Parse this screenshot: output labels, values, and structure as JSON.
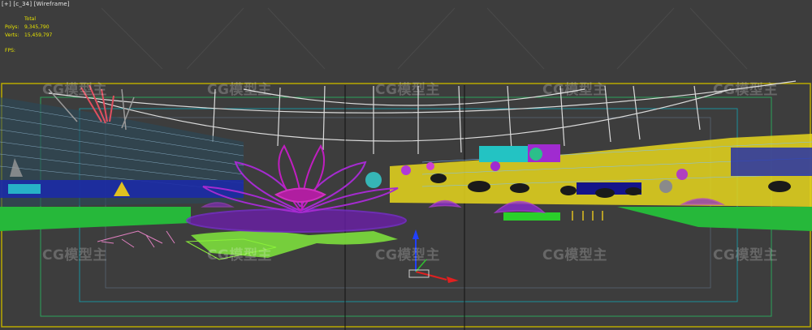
{
  "viewport": {
    "label": "[+] [c_34] [Wireframe]",
    "render_mode": "Wireframe"
  },
  "stats": {
    "header": "Total",
    "polys_label": "Polys:",
    "polys_value": "9,345,790",
    "verts_label": "Verts:",
    "verts_value": "15,459,797",
    "fps_label": "FPS:"
  },
  "watermark": {
    "text": "CG模型主"
  },
  "colors": {
    "background": "#3d3d3d",
    "stats_text": "#e6e200",
    "safe_frame_yellow": "#c8b400",
    "safe_frame_cyan": "#1a8f9a",
    "safe_frame_green": "#2aa35a",
    "lotus_purple": "#a52bd0",
    "lotus_magenta": "#c01ec0",
    "ground_green": "#2bd02b",
    "gizmo_x": "#e02020",
    "gizmo_y": "#30c030",
    "gizmo_z": "#2040ff"
  }
}
